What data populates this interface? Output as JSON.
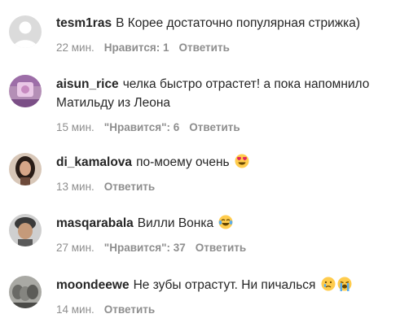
{
  "comments": [
    {
      "username": "tesm1ras",
      "text": "В Корее достаточно популярная стрижка)",
      "time": "22 мин.",
      "likes": "Нравится: 1",
      "reply": "Ответить",
      "avatar": "default-avatar-icon",
      "emoji": []
    },
    {
      "username": "aisun_rice",
      "text": "челка быстро отрастет! а пока напомнило Матильду из Леона",
      "time": "15 мин.",
      "likes": "\"Нравится\": 6",
      "reply": "Ответить",
      "avatar": "profile-photo",
      "emoji": []
    },
    {
      "username": "di_kamalova",
      "text": "по-моему очень",
      "time": "13 мин.",
      "likes": "",
      "reply": "Ответить",
      "avatar": "profile-photo",
      "emoji": [
        "heart-eyes-emoji"
      ]
    },
    {
      "username": "masqarabala",
      "text": "Вилли Вонка",
      "time": "27 мин.",
      "likes": "\"Нравится\": 37",
      "reply": "Ответить",
      "avatar": "profile-photo",
      "emoji": [
        "tears-of-joy-emoji"
      ]
    },
    {
      "username": "moondeewe",
      "text": "Не зубы отрастут. Ни пичалься",
      "time": "14 мин.",
      "likes": "",
      "reply": "Ответить",
      "avatar": "profile-photo",
      "emoji": [
        "crying-face-emoji",
        "loudly-crying-emoji"
      ]
    }
  ],
  "colors": {
    "text": "#262626",
    "meta": "#8e8e8e",
    "background": "#ffffff",
    "emoji_yellow": "#ffcc4d"
  }
}
